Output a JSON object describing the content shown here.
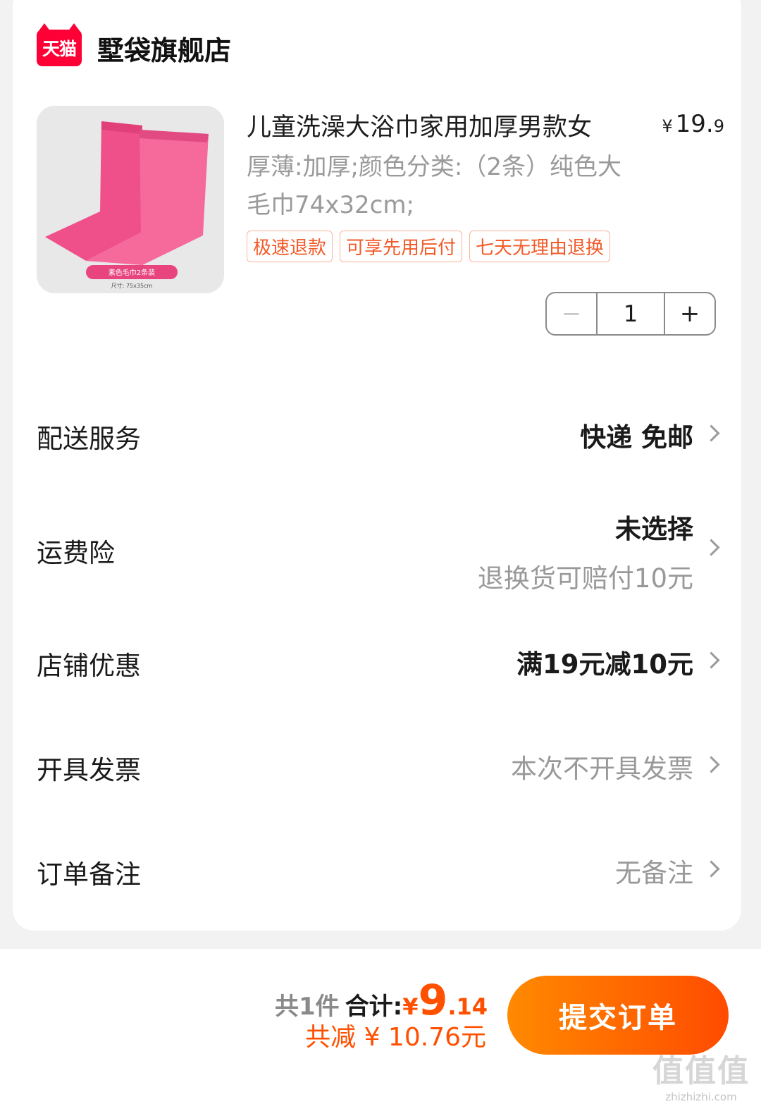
{
  "shop": {
    "badge": "天猫",
    "name": "墅袋旗舰店"
  },
  "product": {
    "image_caption": "素色毛巾2条装",
    "image_size": "尺寸: 75x35cm",
    "title": "儿童洗澡大浴巾家用加厚男款女",
    "price_symbol": "¥",
    "price_int": "19.",
    "price_dec": "9",
    "spec": "厚薄:加厚;颜色分类:（2条）纯色大毛巾74x32cm;",
    "tags": [
      "极速退款",
      "可享先用后付",
      "七天无理由退换"
    ],
    "quantity": "1",
    "minus_label": "−",
    "plus_label": "+"
  },
  "rows": {
    "delivery": {
      "label": "配送服务",
      "value": "快递 免邮"
    },
    "insurance": {
      "label": "运费险",
      "value": "未选择",
      "sub": "退换货可赔付10元"
    },
    "discount": {
      "label": "店铺优惠",
      "value": "满19元减10元"
    },
    "invoice": {
      "label": "开具发票",
      "value": "本次不开具发票"
    },
    "remark": {
      "label": "订单备注",
      "value": "无备注"
    }
  },
  "summary": {
    "count": "共1件",
    "total_label": "合计:",
    "yen": "¥",
    "total_int": "9",
    "total_dec": ".14",
    "saved": "共减 ¥ 10.76元"
  },
  "submit_label": "提交订单",
  "watermark": {
    "main": "值值值",
    "sub": "zhizhizhi.com"
  },
  "colors": {
    "accent": "#ff5000",
    "tmall_red": "#ff0036",
    "tag_text": "#f25b2a",
    "towel_pink": "#f5588a"
  }
}
